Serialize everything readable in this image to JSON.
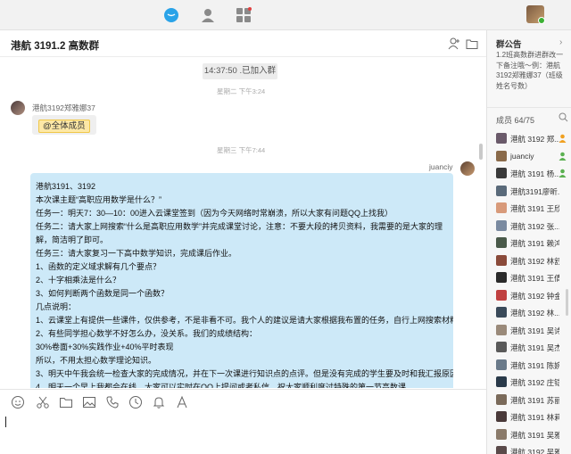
{
  "chat": {
    "title": "港航 3191.2 高数群",
    "system_notice": "14:37:50 .已加入群",
    "timestamps": [
      "星期二 下午3:24",
      "星期三 下午7:44"
    ]
  },
  "messages": [
    {
      "sender": "港航3192郑雅娜37",
      "side": "left",
      "content": "@全体成员"
    },
    {
      "sender": "juanciy",
      "side": "right",
      "lines": [
        "港航3191、3192",
        "本次课主题“高职应用数学是什么？”",
        "任务一：明天7：30—10：00进入云课堂签到（因为今天网络时常崩溃，所以大家有问题QQ上找我）",
        "任务二：请大家上网搜索“什么是高职应用数学”并完成课堂讨论，注意：不要大段的拷贝资料，我需要的是大家的理解，简洁明了即可。",
        "任务三：请大家复习一下高中数学知识，完成课后作业。",
        "1、函数的定义域求解有几个要点？",
        "2、十字相乘法是什么？",
        "3、如何判断两个函数是同一个函数？",
        "几点说明：",
        "1、云课堂上有提供一些课件，仅供参考，不是非看不可。我个人的建议是请大家根据我布置的任务，自行上网搜索材料。",
        "2、有些同学担心数学不好怎么办，没关系。我们的成绩结构：",
        "30%卷面+30%实践作业+40%平时表现",
        "所以，不用太担心数学理论知识。",
        "3、明天中午我会统一检查大家的完成情况，并在下一次课进行知识点的点评。但是没有完成的学生要及时和我汇报原因。",
        "4、明天一个早上我都会在线，大家可以实时在QQ上提问或者私信。祝大家顺利度过特殊的第一节高数课。"
      ]
    }
  ],
  "announcement": {
    "title": "群公告",
    "text": "1.2班高数群进群改一下备注哦～例：港航3192郑雅娜37（班级姓名号数）"
  },
  "members": {
    "header": "成员 64/75",
    "list": [
      {
        "name": "港航 3192 郑...",
        "role": "owner",
        "color": "#6a5a6a"
      },
      {
        "name": "juanciy",
        "role": "admin",
        "color": "#8a6a4a"
      },
      {
        "name": "港航 3191 杨...",
        "role": "admin",
        "color": "#3a3a3a"
      },
      {
        "name": "港航3191廖昕...",
        "role": "",
        "color": "#5a6a7a"
      },
      {
        "name": "港航 3191 王欣...",
        "role": "",
        "color": "#d89a7a"
      },
      {
        "name": "港航 3192 张...",
        "role": "",
        "color": "#7a8aa0"
      },
      {
        "name": "港航 3191 赖鸿...",
        "role": "",
        "color": "#4a5a4a"
      },
      {
        "name": "港航 3192 林舒...",
        "role": "",
        "color": "#8a4a3a"
      },
      {
        "name": "港航 3191 王倩...",
        "role": "",
        "color": "#2a2a2a"
      },
      {
        "name": "港航 3192 钟金...",
        "role": "",
        "color": "#c04040"
      },
      {
        "name": "港航 3192 林...",
        "role": "",
        "color": "#3a4a5a"
      },
      {
        "name": "港航 3191 吴诗...",
        "role": "",
        "color": "#9a8a7a"
      },
      {
        "name": "港航 3191 吴杰...",
        "role": "",
        "color": "#5a5a5a"
      },
      {
        "name": "港航 3191 陈婉...",
        "role": "",
        "color": "#6a7a8a"
      },
      {
        "name": "港航 3192 庄铠...",
        "role": "",
        "color": "#2a3a4a"
      },
      {
        "name": "港航 3191 苏丽...",
        "role": "",
        "color": "#7a6a5a"
      },
      {
        "name": "港航 3191 林莉...",
        "role": "",
        "color": "#4a3a3a"
      },
      {
        "name": "港航 3191 吴雅...",
        "role": "",
        "color": "#8a7a6a"
      },
      {
        "name": "港航 3192 吴雅...",
        "role": "",
        "color": "#5a4a4a"
      }
    ]
  },
  "colors": {
    "bubble_right": "#cde9f8",
    "mention_bg": "#fde8a6",
    "online": "#3cb034",
    "nav_active": "#2aa3e8"
  }
}
